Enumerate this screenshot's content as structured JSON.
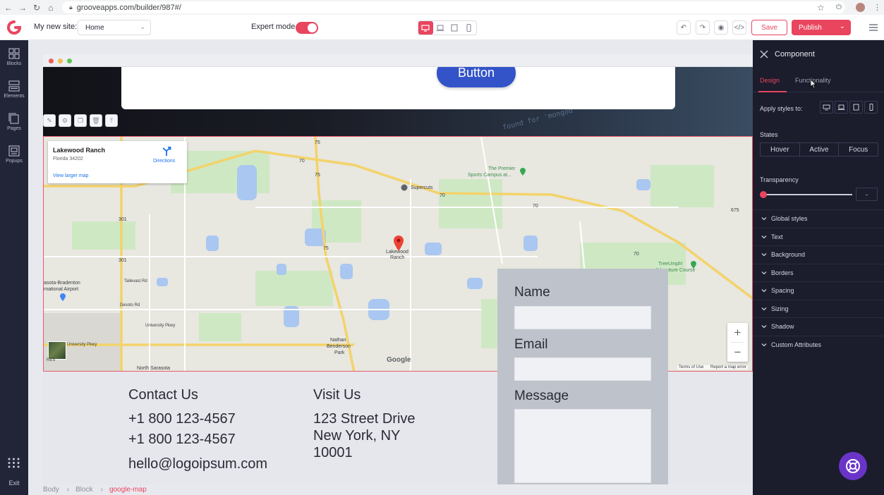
{
  "browser": {
    "url": "grooveapps.com/builder/987#/"
  },
  "toolbar": {
    "site_label": "My new site:",
    "page_select_value": "Home",
    "expert_label": "Expert mode",
    "expert_on": true,
    "save_label": "Save",
    "publish_label": "Publish",
    "accent_color": "#e9455f"
  },
  "left_sidebar": {
    "items": [
      {
        "label": "Blocks",
        "icon": "blocks-icon"
      },
      {
        "label": "Elements",
        "icon": "elements-icon"
      },
      {
        "label": "Pages",
        "icon": "pages-icon"
      },
      {
        "label": "Popups",
        "icon": "popups-icon"
      }
    ],
    "exit_label": "Exit"
  },
  "canvas": {
    "hero_button_label": "Button",
    "hero_code_text": "found for 'mongod'",
    "map": {
      "place_name": "Lakewood Ranch",
      "place_address": "Florida 34202",
      "directions_label": "Directions",
      "view_larger_label": "View larger map",
      "labels": {
        "premier": "The Premier",
        "sports_campus": "Sports Campus at...",
        "supercuts": "Supercuts",
        "pin": "Lakewood",
        "pin2": "Ranch",
        "airport": "asota-Bradenton",
        "airport2": "rnational Airport",
        "treeumph": "TreeUmph!",
        "adventure": "Adventure Course",
        "nathan": "Nathan",
        "benderson": "Benderson",
        "park": "Park",
        "north_sarasota": "North Sarasota",
        "tallevast": "Tallevast Rd",
        "university1": "University Pkwy",
        "university2": "University Pkwy",
        "desoto": "Desoto Rd",
        "road_70a": "70",
        "road_70b": "70",
        "road_70c": "70",
        "road_70d": "70",
        "road_675": "675",
        "road_75a": "75",
        "road_75b": "75",
        "road_75c": "75",
        "road_301": "301",
        "road_301b": "301",
        "thumb_text": "RES"
      },
      "zoom_in": "+",
      "zoom_out": "−",
      "google_mark": "Google",
      "terms": "Terms of Use",
      "report": "Report a map error"
    },
    "contact": {
      "heading": "Contact Us",
      "phone1": "+1 800 123-4567",
      "phone2": "+1 800 123-4567",
      "email": "hello@logoipsum.com"
    },
    "visit": {
      "heading": "Visit Us",
      "line1": "123 Street Drive",
      "line2": "New York, NY",
      "line3": "10001"
    },
    "form": {
      "name_label": "Name",
      "email_label": "Email",
      "message_label": "Message"
    },
    "breadcrumb": [
      "Body",
      "Block",
      "google-map"
    ]
  },
  "right_panel": {
    "title": "Component",
    "tabs": [
      "Design",
      "Functionality"
    ],
    "apply_label": "Apply styles to:",
    "states_label": "States",
    "states": [
      "Hover",
      "Active",
      "Focus"
    ],
    "transparency_label": "Transparency",
    "transparency_value": "-",
    "transparency_fraction": 0,
    "sections": [
      "Global styles",
      "Text",
      "Background",
      "Borders",
      "Spacing",
      "Sizing",
      "Shadow",
      "Custom Attributes"
    ]
  }
}
